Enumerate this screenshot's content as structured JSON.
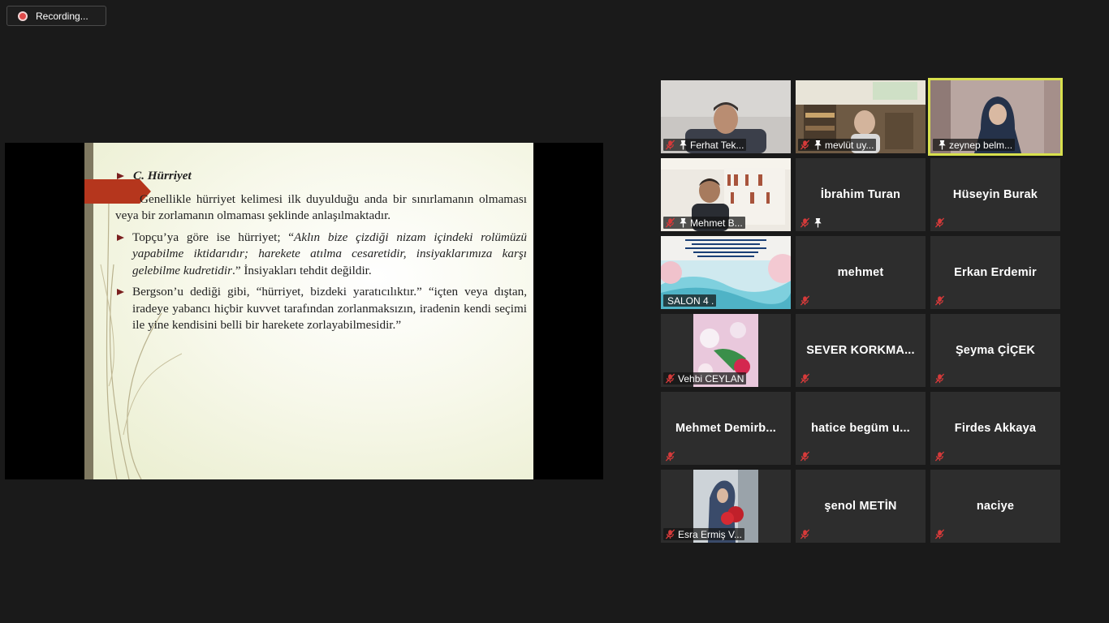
{
  "recording": {
    "label": "Recording..."
  },
  "slide": {
    "heading": "C. Hürriyet",
    "para1": "Genellikle hürriyet kelimesi ilk duyulduğu anda bir sınırlamanın olmaması veya bir zorlamanın olmaması şeklinde anlaşılmaktadır.",
    "para2_prefix": "Topçu’ya göre ise hürriyet; “",
    "para2_italic": "Aklın bize çizdiği nizam içindeki rolümüzü yapabilme iktidarıdır; harekete atılma cesaretidir, insiyaklarımıza karşı gelebilme kudretidir",
    "para2_suffix": ".” İnsiyakları tehdit değildir.",
    "para3": "Bergson’u dediği gibi, “hürriyet, bizdeki yaratıcılıktır.” “içten veya dıştan, iradeye yabancı hiçbir kuvvet tarafından zorlanmaksızın, iradenin kendi seçimi ile yine kendisini belli bir harekete zorlayabilmesidir.”"
  },
  "participants": [
    {
      "name": "Ferhat Tek...",
      "video": true,
      "pinned": true,
      "muted": true
    },
    {
      "name": "mevlüt uy...",
      "video": true,
      "pinned": true,
      "muted": true
    },
    {
      "name": "zeynep belm...",
      "video": true,
      "pinned": true,
      "muted": false,
      "active": true
    },
    {
      "name": "Mehmet B...",
      "video": true,
      "pinned": true,
      "muted": true
    },
    {
      "name": "İbrahim Turan",
      "video": false,
      "pinned": true,
      "muted": true
    },
    {
      "name": "Hüseyin Burak",
      "video": false,
      "pinned": false,
      "muted": true
    },
    {
      "name": "SALON 4 .",
      "video": true,
      "pinned": false,
      "muted": false
    },
    {
      "name": "mehmet",
      "video": false,
      "pinned": false,
      "muted": true
    },
    {
      "name": "Erkan Erdemir",
      "video": false,
      "pinned": false,
      "muted": true
    },
    {
      "name": "Vehbi CEYLAN",
      "video": true,
      "pinned": false,
      "muted": true
    },
    {
      "name": "SEVER KORKMA...",
      "video": false,
      "pinned": false,
      "muted": true
    },
    {
      "name": "Şeyma ÇİÇEK",
      "video": false,
      "pinned": false,
      "muted": true
    },
    {
      "name": "Mehmet Demirb...",
      "video": false,
      "pinned": false,
      "muted": true
    },
    {
      "name": "hatice begüm u...",
      "video": false,
      "pinned": false,
      "muted": true
    },
    {
      "name": "Firdes Akkaya",
      "video": false,
      "pinned": false,
      "muted": true
    },
    {
      "name": "Esra Ermiş V...",
      "video": true,
      "pinned": false,
      "muted": true
    },
    {
      "name": "şenol METİN",
      "video": false,
      "pinned": false,
      "muted": true
    },
    {
      "name": "naciye",
      "video": false,
      "pinned": false,
      "muted": true
    }
  ],
  "colors": {
    "active_speaker": "#d8e04d",
    "mute_icon": "#e03b3b",
    "slide_accent": "#b5361d"
  }
}
